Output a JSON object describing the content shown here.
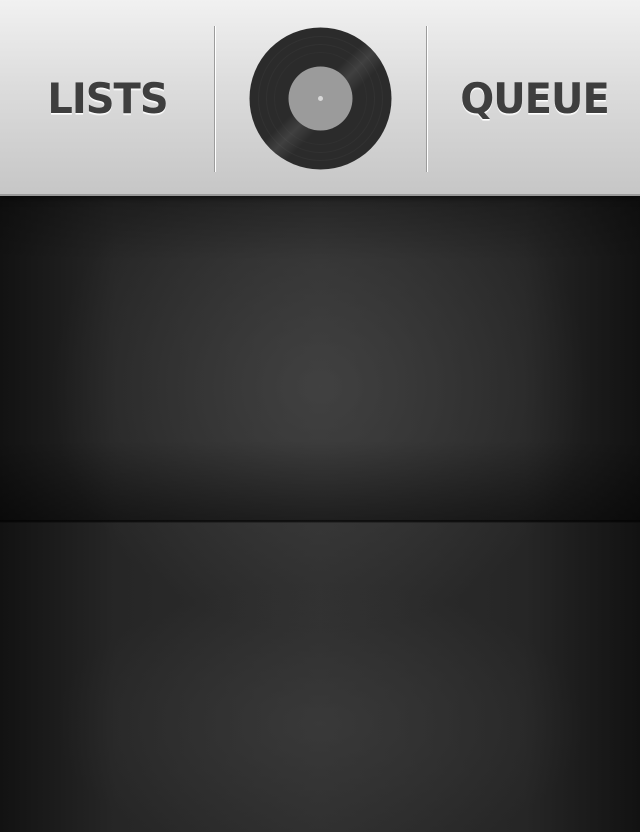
{
  "header": {
    "left_tab_label": "LISTS",
    "right_tab_label": "QUEUE",
    "center_icon": "vinyl-record-icon"
  },
  "colors": {
    "header_top": "#f1f1f1",
    "header_bottom": "#c6c6c6",
    "label_text": "#3e3e3e",
    "record_body": "#2b2b2b",
    "record_label": "#9b9b9b",
    "content_background": "#2a2a2a"
  }
}
